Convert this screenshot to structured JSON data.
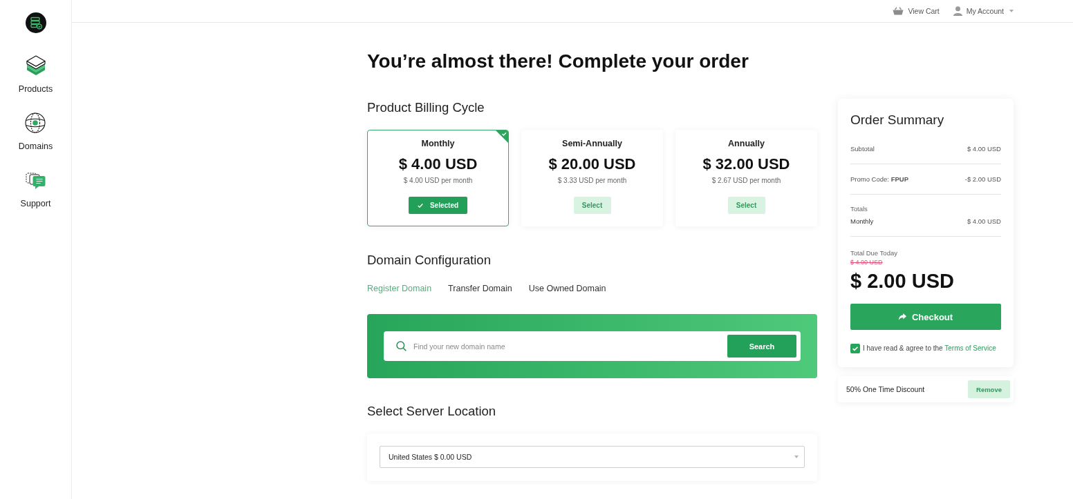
{
  "sidebar": {
    "items": [
      {
        "label": "Products"
      },
      {
        "label": "Domains"
      },
      {
        "label": "Support"
      }
    ]
  },
  "top_bar": {
    "view_cart": "View Cart",
    "account": "My Account"
  },
  "title": "You’re almost there! Complete your order",
  "billing_cycle": {
    "heading": "Product Billing Cycle",
    "options": [
      {
        "name": "Monthly",
        "price": "$ 4.00 USD",
        "per_month": "$ 4.00 USD per month",
        "button": "Selected",
        "selected": true
      },
      {
        "name": "Semi-Annually",
        "price": "$ 20.00 USD",
        "per_month": "$ 3.33 USD per month",
        "button": "Select",
        "selected": false
      },
      {
        "name": "Annually",
        "price": "$ 32.00 USD",
        "per_month": "$ 2.67 USD per month",
        "button": "Select",
        "selected": false
      }
    ]
  },
  "domain_configuration": {
    "heading": "Domain Configuration",
    "tabs": [
      {
        "label": "Register Domain",
        "selected": true
      },
      {
        "label": "Transfer Domain",
        "selected": false
      },
      {
        "label": "Use Owned Domain",
        "selected": false
      }
    ],
    "search": {
      "placeholder": "Find your new domain name",
      "button": "Search"
    }
  },
  "server_location": {
    "heading": "Select Server Location",
    "value": "United States $ 0.00 USD"
  },
  "order_summary": {
    "title": "Order Summary",
    "rows": [
      {
        "label": "Subtotal",
        "value": "$ 4.00 USD"
      },
      {
        "label": "Promo Code: **FPUP**",
        "value": "-$ 2.00 USD"
      }
    ],
    "totals": {
      "label": "Totals",
      "cycle": "Monthly",
      "value": "$ 4.00 USD"
    },
    "total_due": {
      "label": "Total Due Today",
      "original": "$ 4.00 USD",
      "amount": "$ 2.00 USD"
    },
    "checkout": "Checkout",
    "terms": {
      "checked": true,
      "text": "I have read & agree to the",
      "link": "Terms of Service"
    }
  },
  "discount": {
    "label": "50% One Time Discount",
    "button": "Remove"
  }
}
